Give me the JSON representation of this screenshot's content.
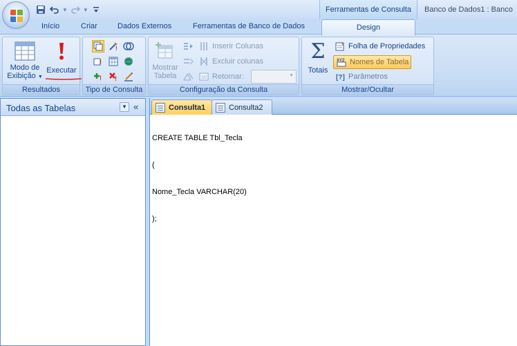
{
  "window": {
    "app_title": "Banco de Dados1 : Banco",
    "context_tab_header": "Ferramentas de Consulta"
  },
  "quick_access": {
    "icons": [
      "save-icon",
      "undo-icon",
      "redo-icon",
      "customize-icon"
    ]
  },
  "tabs": [
    {
      "label": "Início"
    },
    {
      "label": "Criar"
    },
    {
      "label": "Dados Externos"
    },
    {
      "label": "Ferramentas de Banco de Dados"
    },
    {
      "label": "Design"
    }
  ],
  "ribbon": {
    "resultados": {
      "label": "Resultados",
      "view_button_line1": "Modo de",
      "view_button_line2": "Exibição",
      "run_button": "Executar"
    },
    "tipo_consulta": {
      "label": "Tipo de Consulta"
    },
    "configuracao": {
      "label": "Configuração da Consulta",
      "show_table_line1": "Mostrar",
      "show_table_line2": "Tabela",
      "insert_columns": "Inserir Colunas",
      "delete_columns": "Excluir colunas",
      "return_label": "Retornar:",
      "return_value": ""
    },
    "mostrar_ocultar": {
      "label": "Mostrar/Ocultar",
      "totals": "Totais",
      "property_sheet": "Folha de Propriedades",
      "table_names": "Nomes de Tabela",
      "table_names_icon_text": "XYZ",
      "parameters": "Parâmetros"
    }
  },
  "nav_pane": {
    "title": "Todas as Tabelas"
  },
  "document": {
    "tabs": [
      {
        "label": "Consulta1",
        "active": true
      },
      {
        "label": "Consulta2",
        "active": false
      }
    ],
    "sql_lines": [
      "CREATE TABLE Tbl_Tecla",
      "(",
      "Nome_Tecla VARCHAR(20)",
      ");"
    ]
  },
  "colors": {
    "ribbon_bg": "#dbe8f8",
    "active_doc_tab": "#ffcf5a",
    "annotation": "#e02020",
    "label_text": "#15428b"
  }
}
